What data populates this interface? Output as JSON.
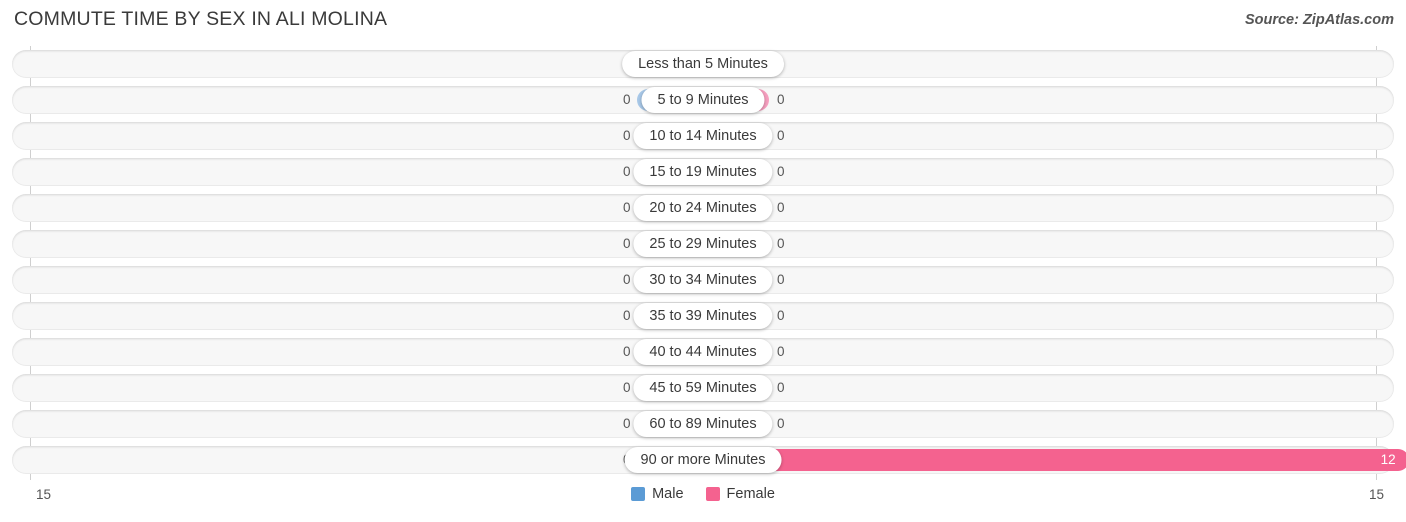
{
  "header": {
    "title": "COMMUTE TIME BY SEX IN ALI MOLINA",
    "source": "Source: ZipAtlas.com"
  },
  "legend": {
    "male_label": "Male",
    "female_label": "Female",
    "male_color": "#5b9bd5",
    "female_color": "#f4628f"
  },
  "axis": {
    "left_tick": "15",
    "right_tick": "15"
  },
  "chart_data": {
    "type": "bar",
    "orientation": "horizontal-diverging",
    "title": "COMMUTE TIME BY SEX IN ALI MOLINA",
    "xlabel": "",
    "ylabel": "",
    "xlim": [
      15,
      15
    ],
    "grid": false,
    "legend_position": "bottom-center",
    "categories": [
      "Less than 5 Minutes",
      "5 to 9 Minutes",
      "10 to 14 Minutes",
      "15 to 19 Minutes",
      "20 to 24 Minutes",
      "25 to 29 Minutes",
      "30 to 34 Minutes",
      "35 to 39 Minutes",
      "40 to 44 Minutes",
      "45 to 59 Minutes",
      "60 to 89 Minutes",
      "90 or more Minutes"
    ],
    "series": [
      {
        "name": "Male",
        "values": [
          0,
          0,
          0,
          0,
          0,
          0,
          0,
          0,
          0,
          0,
          0,
          0
        ],
        "color": "#a8c8e8"
      },
      {
        "name": "Female",
        "values": [
          0,
          0,
          0,
          0,
          0,
          0,
          0,
          0,
          0,
          0,
          0,
          12
        ],
        "color": "#f59ebe"
      }
    ]
  },
  "rows": [
    {
      "label": "Less than 5 Minutes",
      "male": "0",
      "female": "0"
    },
    {
      "label": "5 to 9 Minutes",
      "male": "0",
      "female": "0"
    },
    {
      "label": "10 to 14 Minutes",
      "male": "0",
      "female": "0"
    },
    {
      "label": "15 to 19 Minutes",
      "male": "0",
      "female": "0"
    },
    {
      "label": "20 to 24 Minutes",
      "male": "0",
      "female": "0"
    },
    {
      "label": "25 to 29 Minutes",
      "male": "0",
      "female": "0"
    },
    {
      "label": "30 to 34 Minutes",
      "male": "0",
      "female": "0"
    },
    {
      "label": "35 to 39 Minutes",
      "male": "0",
      "female": "0"
    },
    {
      "label": "40 to 44 Minutes",
      "male": "0",
      "female": "0"
    },
    {
      "label": "45 to 59 Minutes",
      "male": "0",
      "female": "0"
    },
    {
      "label": "60 to 89 Minutes",
      "male": "0",
      "female": "0"
    },
    {
      "label": "90 or more Minutes",
      "male": "0",
      "female": "12"
    }
  ]
}
